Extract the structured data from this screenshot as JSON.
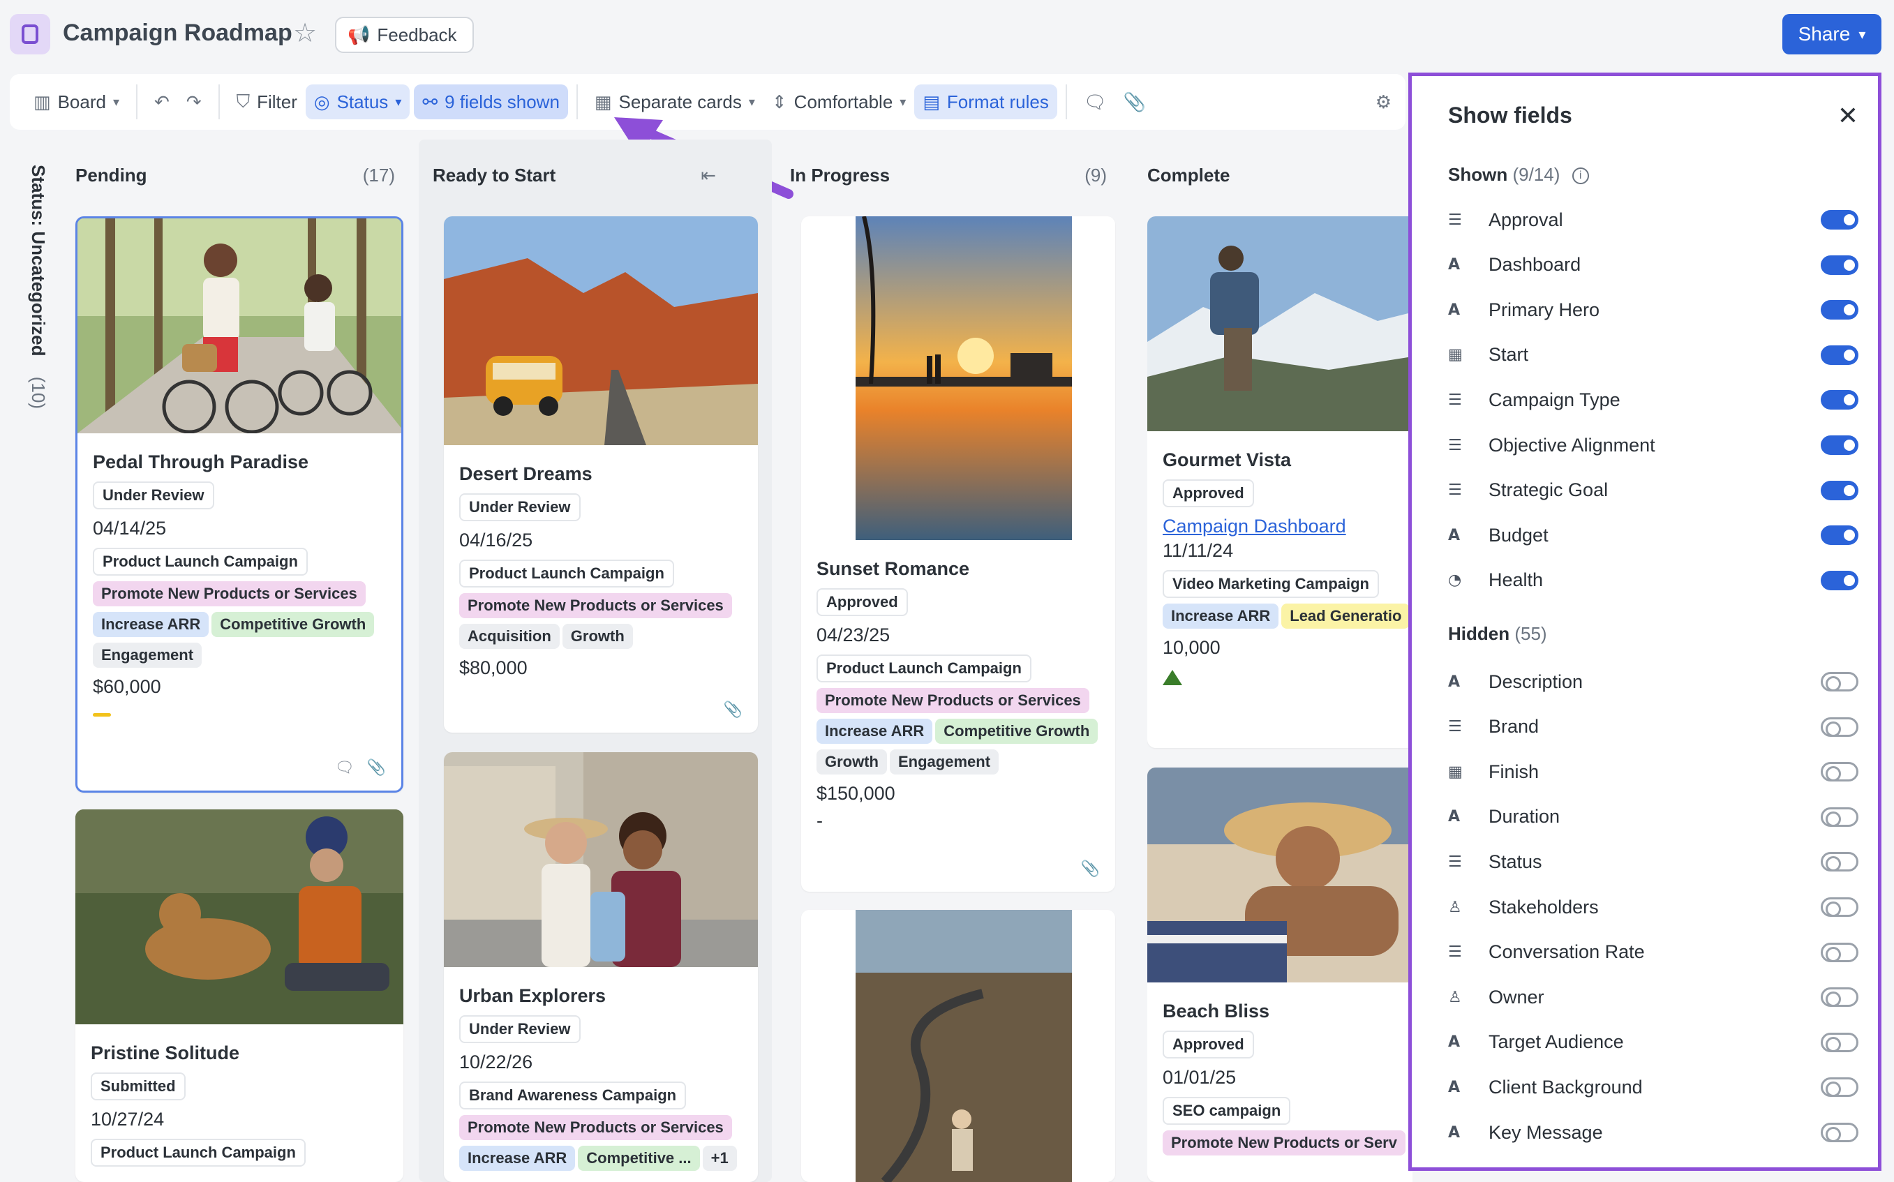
{
  "header": {
    "title": "Campaign Roadmap",
    "feedback_label": "Feedback",
    "share_label": "Share"
  },
  "toolbar": {
    "board_label": "Board",
    "filter_label": "Filter",
    "status_label": "Status",
    "fields_label": "9 fields shown",
    "cards_label": "Separate cards",
    "density_label": "Comfortable",
    "format_label": "Format rules"
  },
  "board": {
    "uncategorized": {
      "label": "Status: Uncategorized",
      "count": "(10)"
    },
    "columns": [
      {
        "title": "Pending",
        "count": "(17)"
      },
      {
        "title": "Ready to Start",
        "count": ""
      },
      {
        "title": "In Progress",
        "count": "(9)"
      },
      {
        "title": "Complete",
        "count": ""
      }
    ],
    "cards": {
      "pedal": {
        "title": "Pedal Through Paradise",
        "approval": "Under Review",
        "start": "04/14/25",
        "type": "Product Launch Campaign",
        "objective": "Promote New Products or Services",
        "goal1": "Increase ARR",
        "goal2": "Competitive Growth",
        "goal3": "Engagement",
        "budget": "$60,000"
      },
      "pristine": {
        "title": "Pristine Solitude",
        "approval": "Submitted",
        "start": "10/27/24",
        "type": "Product Launch Campaign"
      },
      "desert": {
        "title": "Desert Dreams",
        "approval": "Under Review",
        "start": "04/16/25",
        "type": "Product Launch Campaign",
        "objective": "Promote New Products or Services",
        "goal1": "Acquisition",
        "goal2": "Growth",
        "budget": "$80,000"
      },
      "urban": {
        "title": "Urban Explorers",
        "approval": "Under Review",
        "start": "10/22/26",
        "type": "Brand Awareness Campaign",
        "objective": "Promote New Products or Services",
        "goal1": "Increase ARR",
        "goal2": "Competitive ...",
        "more": "+1"
      },
      "sunset": {
        "title": "Sunset Romance",
        "approval": "Approved",
        "start": "04/23/25",
        "type": "Product Launch Campaign",
        "objective": "Promote New Products or Services",
        "goal1": "Increase ARR",
        "goal2": "Competitive Growth",
        "goal3": "Growth",
        "goal4": "Engagement",
        "budget": "$150,000",
        "health": "-"
      },
      "gourmet": {
        "title": "Gourmet Vista",
        "approval": "Approved",
        "dashboard": "Campaign Dashboard",
        "start": "11/11/24",
        "type": "Video Marketing Campaign",
        "goal1": "Increase ARR",
        "goal2": "Lead Generatio",
        "budget": "10,000"
      },
      "beach": {
        "title": "Beach Bliss",
        "approval": "Approved",
        "start": "01/01/25",
        "type": "SEO campaign",
        "objective": "Promote New Products or Serv"
      }
    }
  },
  "panel": {
    "title": "Show fields",
    "shown_label": "Shown",
    "shown_count": "(9/14)",
    "hidden_label": "Hidden",
    "hidden_count": "(55)",
    "shown_fields": [
      {
        "name": "Approval",
        "icon": "list-icon"
      },
      {
        "name": "Dashboard",
        "icon": "ai-text-icon"
      },
      {
        "name": "Primary Hero",
        "icon": "ai-text-icon"
      },
      {
        "name": "Start",
        "icon": "calendar-icon"
      },
      {
        "name": "Campaign Type",
        "icon": "list-icon"
      },
      {
        "name": "Objective Alignment",
        "icon": "list-icon"
      },
      {
        "name": "Strategic Goal",
        "icon": "list-icon"
      },
      {
        "name": "Budget",
        "icon": "ai-text-icon"
      },
      {
        "name": "Health",
        "icon": "health-icon"
      }
    ],
    "hidden_fields": [
      {
        "name": "Description",
        "icon": "ai-text-icon"
      },
      {
        "name": "Brand",
        "icon": "list-icon"
      },
      {
        "name": "Finish",
        "icon": "calendar-icon"
      },
      {
        "name": "Duration",
        "icon": "ai-text-icon"
      },
      {
        "name": "Status",
        "icon": "list-icon"
      },
      {
        "name": "Stakeholders",
        "icon": "person-icon"
      },
      {
        "name": "Conversation Rate",
        "icon": "list-icon"
      },
      {
        "name": "Owner",
        "icon": "person-icon"
      },
      {
        "name": "Target Audience",
        "icon": "ai-text-icon"
      },
      {
        "name": "Client Background",
        "icon": "ai-text-icon"
      },
      {
        "name": "Key Message",
        "icon": "ai-text-icon"
      }
    ]
  },
  "colors": {
    "accent": "#2b63d9",
    "panel_border": "#8d4fd8",
    "arrow": "#8d4fd8"
  }
}
